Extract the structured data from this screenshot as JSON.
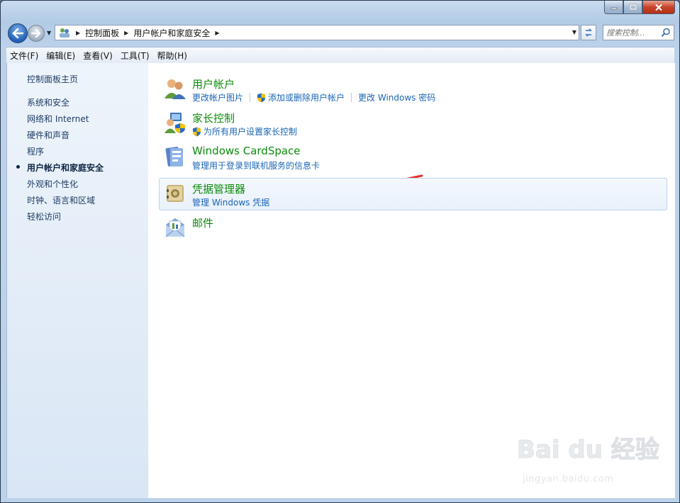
{
  "window": {
    "caption_buttons": [
      "minimize",
      "maximize",
      "close"
    ]
  },
  "nav": {
    "back_icon": "back-arrow-icon",
    "forward_icon": "forward-arrow-icon",
    "breadcrumbs": [
      "控制面板",
      "用户帐户和家庭安全"
    ],
    "search_placeholder": "搜索控制..."
  },
  "menubar": {
    "items": [
      "文件(F)",
      "编辑(E)",
      "查看(V)",
      "工具(T)",
      "帮助(H)"
    ]
  },
  "sidebar": {
    "home": "控制面板主页",
    "items": [
      "系统和安全",
      "网络和 Internet",
      "硬件和声音",
      "程序",
      "用户帐户和家庭安全",
      "外观和个性化",
      "时钟、语言和区域",
      "轻松访问"
    ],
    "current_index": 4
  },
  "main": {
    "categories": [
      {
        "title": "用户帐户",
        "icon": "user-accounts-icon",
        "links": [
          {
            "label": "更改帐户图片",
            "shield": false
          },
          {
            "label": "添加或删除用户帐户",
            "shield": true
          },
          {
            "label": "更改 Windows 密码",
            "shield": false
          }
        ]
      },
      {
        "title": "家长控制",
        "icon": "parental-controls-icon",
        "links": [
          {
            "label": "为所有用户设置家长控制",
            "shield": true
          }
        ]
      },
      {
        "title": "Windows CardSpace",
        "icon": "cardspace-icon",
        "links": [
          {
            "label": "管理用于登录到联机服务的信息卡",
            "shield": false
          }
        ]
      },
      {
        "title": "凭据管理器",
        "icon": "credential-manager-icon",
        "links": [
          {
            "label": "管理 Windows 凭据",
            "shield": false
          }
        ]
      },
      {
        "title": "邮件",
        "icon": "mail-icon",
        "links": []
      }
    ]
  },
  "watermark": {
    "logo_text": "Bai du 经验",
    "url": "jingyan.baidu.com"
  },
  "colors": {
    "category_title": "#0c8c0c",
    "task_link": "#1a64b6",
    "annotation_arrow": "#e8312a"
  }
}
